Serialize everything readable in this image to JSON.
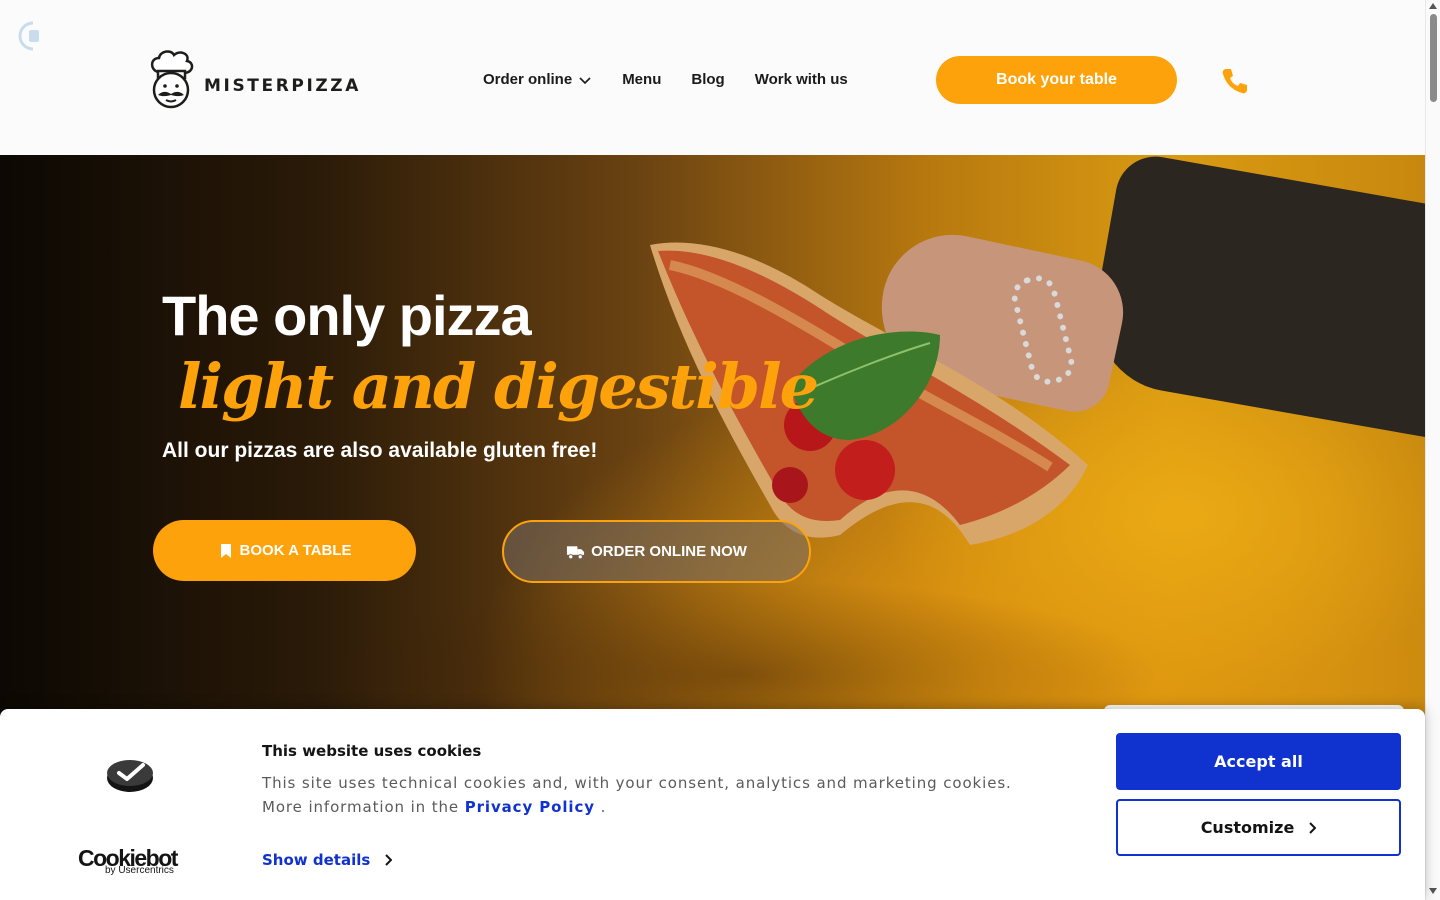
{
  "header": {
    "logo_text": "MISTERPIZZA",
    "nav": [
      {
        "label": "Order online",
        "has_dropdown": true
      },
      {
        "label": "Menu"
      },
      {
        "label": "Blog"
      },
      {
        "label": "Work with us"
      }
    ],
    "book_button": "Book your table",
    "phone_icon": "phone-icon"
  },
  "hero": {
    "title_line1": "The only pizza",
    "title_line2": "light and digestible",
    "subtitle": "All our pizzas are also available gluten free!",
    "book_button": "BOOK A TABLE",
    "order_button": "ORDER ONLINE NOW"
  },
  "cookie_banner": {
    "brand": "Cookiebot",
    "brand_sub": "by Usercentrics",
    "title": "This website uses cookies",
    "text": "This site uses technical cookies and, with your consent, analytics and marketing cookies. More information in the",
    "link": "Privacy Policy",
    "text_end": ".",
    "show_details": "Show details",
    "accept": "Accept all",
    "customize": "Customize"
  },
  "colors": {
    "accent": "#fda20a",
    "cookie_blue": "#1032cf",
    "text_dark": "#1b1b1b"
  }
}
